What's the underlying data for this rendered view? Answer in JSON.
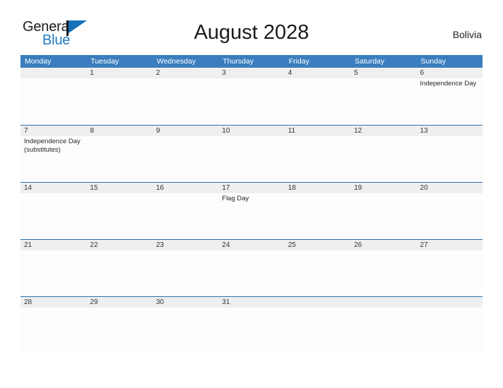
{
  "brand": {
    "name_part1": "General",
    "name_part2": "Blue",
    "flag_icon": "flag-icon"
  },
  "header": {
    "title": "August 2028",
    "country": "Bolivia"
  },
  "colors": {
    "header_blue": "#3a7ebf",
    "row_divider_blue": "#2e6da4",
    "date_band_gray": "#efefef",
    "logo_blue": "#1f7ac2",
    "page_background": "#ffffff"
  },
  "calendar": {
    "weekdays": [
      "Monday",
      "Tuesday",
      "Wednesday",
      "Thursday",
      "Friday",
      "Saturday",
      "Sunday"
    ],
    "weeks": [
      [
        {
          "day": "",
          "event": ""
        },
        {
          "day": "1",
          "event": ""
        },
        {
          "day": "2",
          "event": ""
        },
        {
          "day": "3",
          "event": ""
        },
        {
          "day": "4",
          "event": ""
        },
        {
          "day": "5",
          "event": ""
        },
        {
          "day": "6",
          "event": "Independence Day"
        }
      ],
      [
        {
          "day": "7",
          "event": "Independence Day (substitutes)"
        },
        {
          "day": "8",
          "event": ""
        },
        {
          "day": "9",
          "event": ""
        },
        {
          "day": "10",
          "event": ""
        },
        {
          "day": "11",
          "event": ""
        },
        {
          "day": "12",
          "event": ""
        },
        {
          "day": "13",
          "event": ""
        }
      ],
      [
        {
          "day": "14",
          "event": ""
        },
        {
          "day": "15",
          "event": ""
        },
        {
          "day": "16",
          "event": ""
        },
        {
          "day": "17",
          "event": "Flag Day"
        },
        {
          "day": "18",
          "event": ""
        },
        {
          "day": "19",
          "event": ""
        },
        {
          "day": "20",
          "event": ""
        }
      ],
      [
        {
          "day": "21",
          "event": ""
        },
        {
          "day": "22",
          "event": ""
        },
        {
          "day": "23",
          "event": ""
        },
        {
          "day": "24",
          "event": ""
        },
        {
          "day": "25",
          "event": ""
        },
        {
          "day": "26",
          "event": ""
        },
        {
          "day": "27",
          "event": ""
        }
      ],
      [
        {
          "day": "28",
          "event": ""
        },
        {
          "day": "29",
          "event": ""
        },
        {
          "day": "30",
          "event": ""
        },
        {
          "day": "31",
          "event": ""
        },
        {
          "day": "",
          "event": ""
        },
        {
          "day": "",
          "event": ""
        },
        {
          "day": "",
          "event": ""
        }
      ]
    ]
  }
}
